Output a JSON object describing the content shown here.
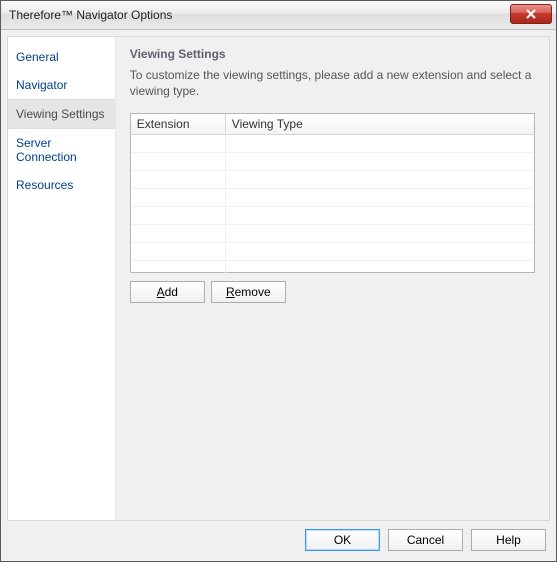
{
  "window": {
    "title": "Therefore™ Navigator Options"
  },
  "sidebar": {
    "items": [
      {
        "label": "General",
        "selected": false
      },
      {
        "label": "Navigator",
        "selected": false
      },
      {
        "label": "Viewing Settings",
        "selected": true
      },
      {
        "label": "Server Connection",
        "selected": false
      },
      {
        "label": "Resources",
        "selected": false
      }
    ]
  },
  "content": {
    "title": "Viewing Settings",
    "description": "To customize the viewing settings, please add a new extension and select a viewing type.",
    "table": {
      "columns": [
        "Extension",
        "Viewing Type"
      ],
      "rows": []
    },
    "buttons": {
      "add_prefix": "A",
      "add_rest": "dd",
      "remove_prefix": "R",
      "remove_rest": "emove"
    }
  },
  "footer": {
    "ok": "OK",
    "cancel": "Cancel",
    "help": "Help"
  }
}
